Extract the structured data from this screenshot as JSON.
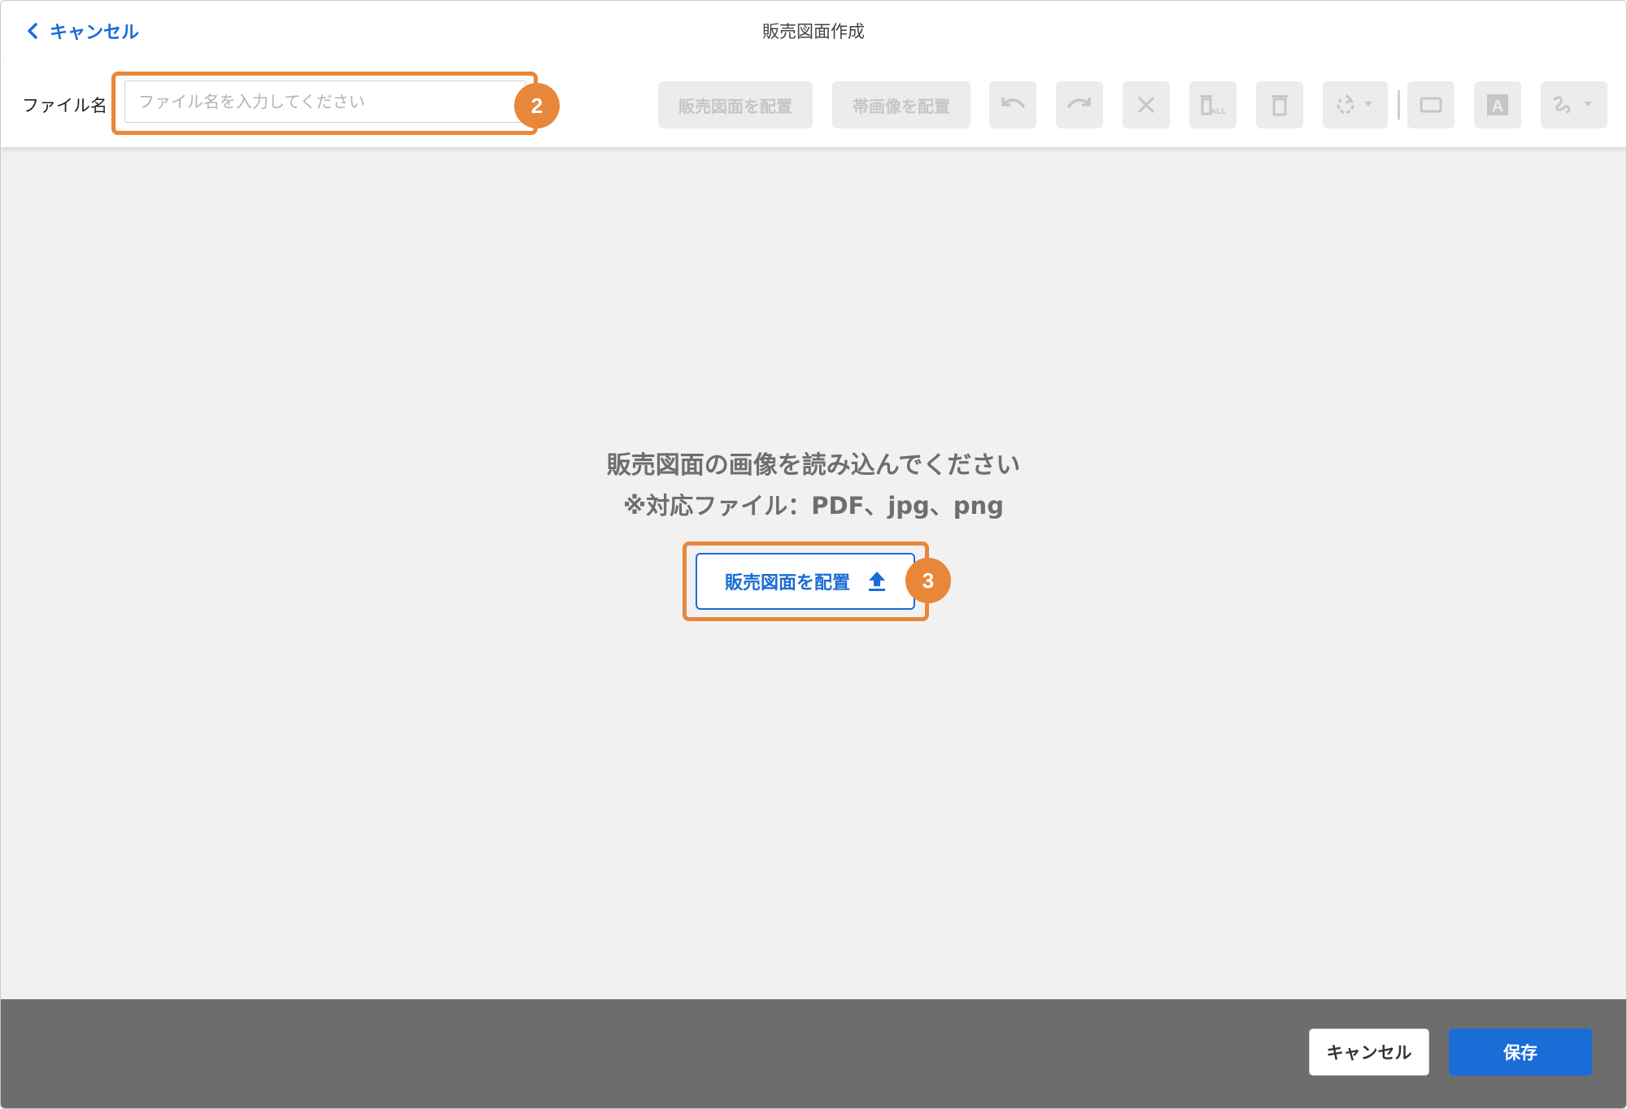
{
  "header": {
    "back_label": "キャンセル",
    "title": "販売図面作成"
  },
  "toolbar": {
    "filename_label": "ファイル名",
    "filename_value": "",
    "filename_placeholder": "ファイル名を入力してください",
    "place_drawing_label": "販売図面を配置",
    "place_band_label": "帯画像を配置",
    "icons": [
      "undo-icon",
      "redo-icon",
      "close-icon",
      "delete-all-icon",
      "trash-icon",
      "rotate-icon",
      "rectangle-icon",
      "text-icon",
      "freehand-icon"
    ]
  },
  "annotations": {
    "badge_filename": "2",
    "badge_upload": "3",
    "highlight_color": "#e8873a"
  },
  "main": {
    "prompt": "販売図面の画像を読み込んでください",
    "note": "※対応ファイル：PDF、jpg、png",
    "upload_label": "販売図面を配置"
  },
  "footer": {
    "cancel_label": "キャンセル",
    "save_label": "保存"
  },
  "colors": {
    "accent": "#1a6dd6",
    "footer_bg": "#6d6d6d",
    "canvas_bg": "#f1f1f1"
  }
}
